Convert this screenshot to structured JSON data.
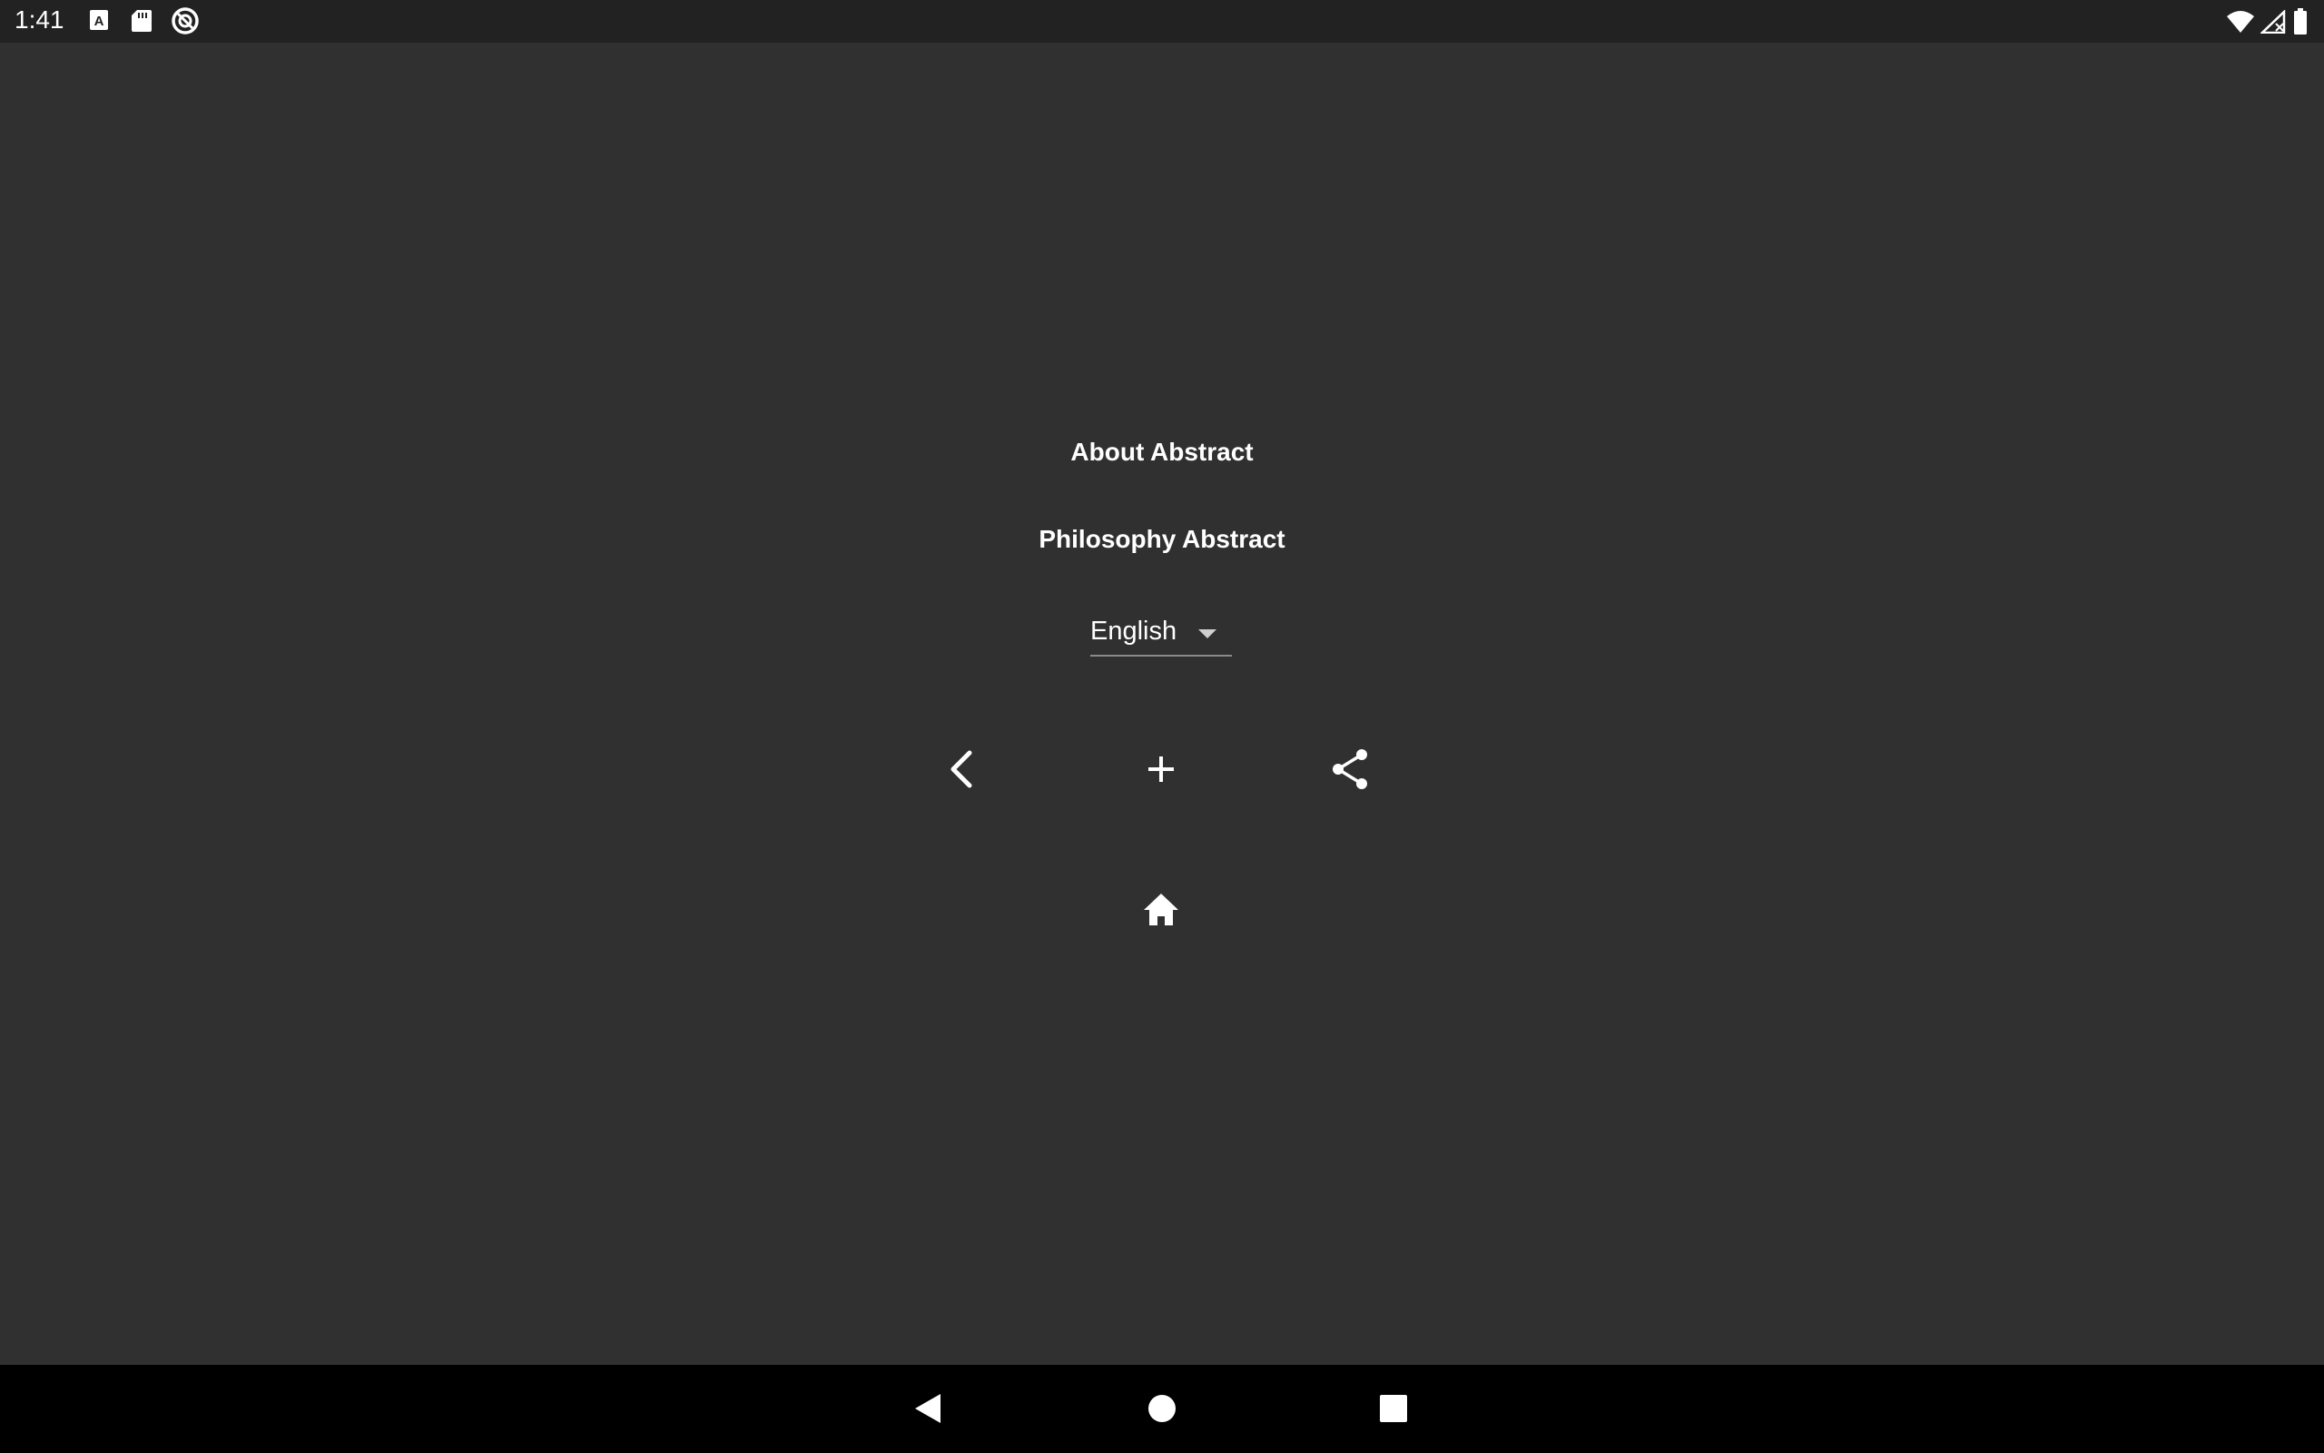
{
  "status_bar": {
    "time": "1:41",
    "left_icons": [
      "font-a-icon",
      "sd-card-icon",
      "sync-icon"
    ],
    "right_icons": [
      "wifi-icon",
      "cell-signal-icon",
      "battery-icon"
    ]
  },
  "menu": {
    "about_label": "About Abstract",
    "philosophy_label": "Philosophy Abstract"
  },
  "language": {
    "selected": "English"
  },
  "actions": {
    "icons": [
      "chevron-left-icon",
      "plus-icon",
      "share-icon",
      "home-icon"
    ]
  },
  "nav_bar": {
    "icons": [
      "back-triangle-icon",
      "home-circle-icon",
      "recents-square-icon"
    ]
  }
}
